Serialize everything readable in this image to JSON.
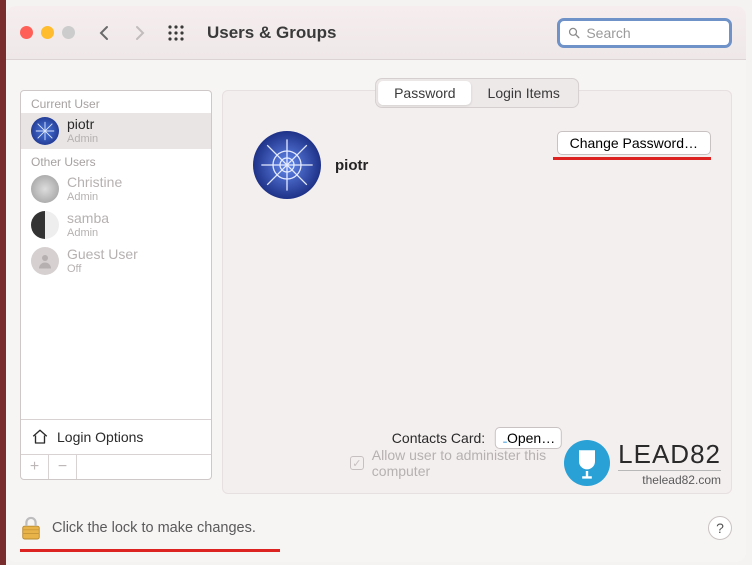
{
  "toolbar": {
    "title": "Users & Groups",
    "search_placeholder": "Search"
  },
  "sidebar": {
    "current_label": "Current User",
    "other_label": "Other Users",
    "users": [
      {
        "name": "piotr",
        "role": "Admin"
      },
      {
        "name": "Christine",
        "role": "Admin"
      },
      {
        "name": "samba",
        "role": "Admin"
      },
      {
        "name": "Guest User",
        "role": "Off"
      }
    ],
    "login_options": "Login Options"
  },
  "main": {
    "tabs": {
      "password": "Password",
      "login_items": "Login Items"
    },
    "user_name": "piotr",
    "change_password": "Change Password…",
    "contacts_label": "Contacts Card:",
    "open_label": "Open…",
    "admin_label": "Allow user to administer this computer"
  },
  "watermark": {
    "brand": "LEAD82",
    "site": "thelead82.com"
  },
  "footer": {
    "lock_text": "Click the lock to make changes.",
    "help": "?"
  }
}
